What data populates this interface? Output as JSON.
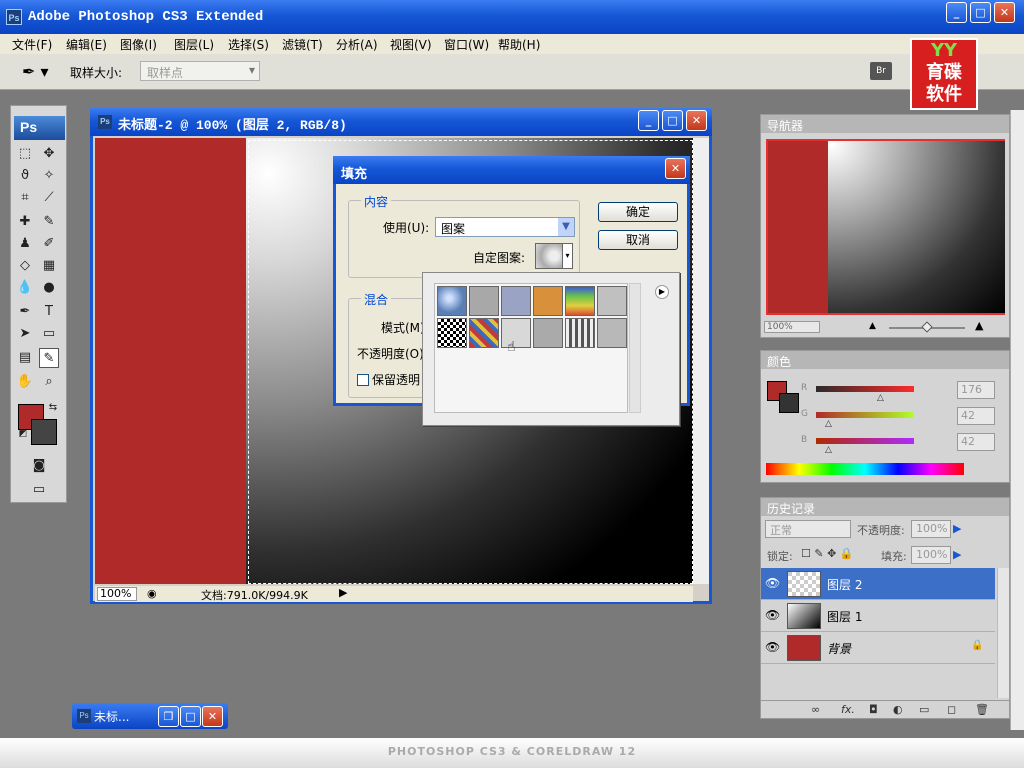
{
  "app": {
    "title": "Adobe Photoshop CS3 Extended",
    "ps_icon": "Ps"
  },
  "menu": [
    "文件(F)",
    "编辑(E)",
    "图像(I)",
    "图层(L)",
    "选择(S)",
    "滤镜(T)",
    "分析(A)",
    "视图(V)",
    "窗口(W)",
    "帮助(H)"
  ],
  "options": {
    "sample_size_label": "取样大小:",
    "sample_size_value": "取样点",
    "bridge_label": "Br"
  },
  "logo": {
    "mark": "YY",
    "text1": "育碟",
    "text2": "软件"
  },
  "tools": {
    "ps_label": "Ps"
  },
  "document": {
    "title": "未标题-2 @ 100% (图层 2, RGB/8)",
    "zoom": "100%",
    "doc_info": "文档:791.0K/994.9K",
    "canvas_color": "#b12a2a"
  },
  "fill_dialog": {
    "title": "填充",
    "content_group": "内容",
    "use_label": "使用(U):",
    "use_value": "图案",
    "custom_pattern_label": "自定图案:",
    "blend_group": "混合",
    "mode_label": "模式(M)",
    "opacity_label": "不透明度(O)",
    "preserve_label": "保留透明",
    "ok_label": "确定",
    "cancel_label": "取消"
  },
  "pattern_swatches": [
    {
      "name": "bubbles",
      "color": "#5a7fb5"
    },
    {
      "name": "wrinkle",
      "color": "#a8a8a8"
    },
    {
      "name": "blue-gray",
      "color": "#9ba3c4"
    },
    {
      "name": "orange",
      "color": "#d9903a"
    },
    {
      "name": "rainbow-strip",
      "color": "#6aa356"
    },
    {
      "name": "marble",
      "color": "#c0c0c0"
    },
    {
      "name": "checker",
      "color": "#333333"
    },
    {
      "name": "multicolor",
      "color": "#8a5aa8"
    },
    {
      "name": "clouds",
      "color": "#d8d8d8"
    },
    {
      "name": "noise",
      "color": "#aaaaaa"
    },
    {
      "name": "chevrons",
      "color": "#777777"
    },
    {
      "name": "granite",
      "color": "#b8b8b8"
    }
  ],
  "navigator": {
    "title": "导航器",
    "zoom": "100%"
  },
  "color_panel": {
    "title": "颜色",
    "r_label": "R",
    "r_value": "176",
    "g_label": "G",
    "g_value": "42",
    "b_label": "B",
    "b_value": "42"
  },
  "history_panel": {
    "title": "历史记录",
    "blend_mode": "正常",
    "opacity_label": "不透明度:",
    "opacity_value": "100%",
    "lock_label": "锁定:",
    "fill_label": "填充:",
    "fill_value": "100%",
    "layers": [
      {
        "name": "图层 2",
        "selected": true
      },
      {
        "name": "图层 1",
        "selected": false
      },
      {
        "name": "背景",
        "selected": false
      }
    ]
  },
  "minimized": {
    "title": "未标..."
  },
  "footer": {
    "text": "PHOTOSHOP CS3 & CORELDRAW 12"
  }
}
